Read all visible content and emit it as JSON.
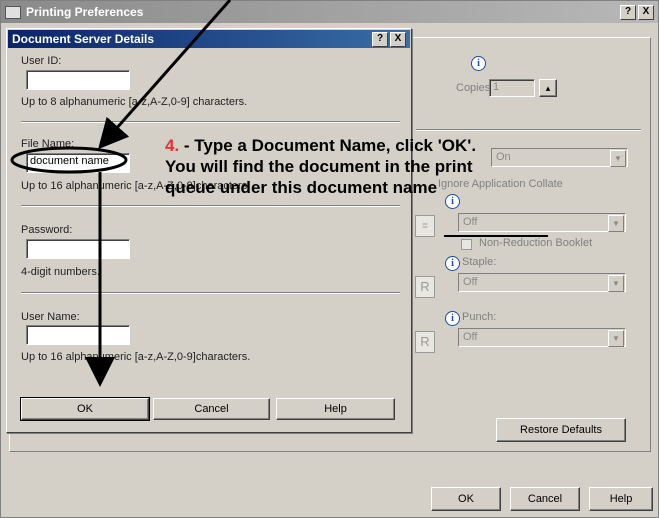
{
  "background_window": {
    "title": "Printing Preferences",
    "help_button": "?",
    "close_button": "X",
    "copies_label": "Copies:",
    "copies_value": "1",
    "collate_value": "On",
    "ignore_collate_label": "Ignore Application Collate",
    "booklet_value": "Off",
    "non_reduction_label": "Non-Reduction Booklet",
    "staple_label": "Staple:",
    "staple_value": "Off",
    "punch_label": "Punch:",
    "punch_value": "Off",
    "r_glyph": "R",
    "restore_defaults_label": "Restore Defaults",
    "ok_label": "OK",
    "cancel_label": "Cancel",
    "help_label": "Help"
  },
  "dialog": {
    "title": "Document Server Details",
    "help_button": "?",
    "close_button": "X",
    "user_id_label": "User ID:",
    "user_id_value": "",
    "user_id_hint": "Up to 8 alphanumeric [a-z,A-Z,0-9] characters.",
    "file_name_label": "File Name:",
    "file_name_value": "document name",
    "file_name_hint": "Up to 16 alphanumeric [a-z,A-Z,0-9]characters.",
    "password_label": "Password:",
    "password_value": "",
    "password_hint": "4-digit numbers.",
    "user_name_label": "User Name:",
    "user_name_value": "",
    "user_name_hint": "Up to 16 alphanumeric [a-z,A-Z,0-9]characters.",
    "ok_label": "OK",
    "cancel_label": "Cancel",
    "help_label": "Help"
  },
  "annotation": {
    "step_number": "4.",
    "line1": " - Type a Document Name, click 'OK'.",
    "line2": "You will find the document in the print",
    "line3": "queue under this document name"
  },
  "colors": {
    "annotation_number": "#e8302a",
    "dialog_title_bar": "#0a246a"
  }
}
